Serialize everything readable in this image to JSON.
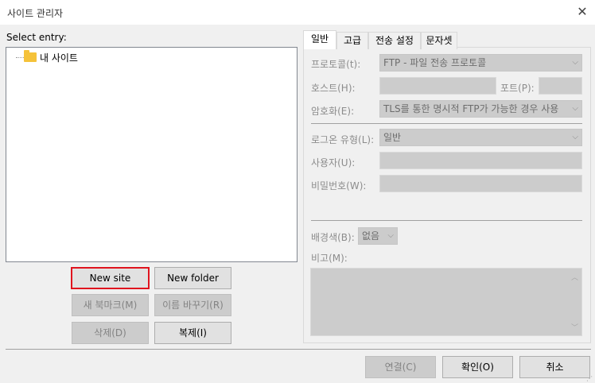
{
  "window": {
    "title": "사이트 관리자",
    "close_icon": "close-icon"
  },
  "left": {
    "select_label": "Select entry:",
    "tree": [
      {
        "label": "내 사이트",
        "icon": "folder-icon"
      }
    ],
    "buttons": {
      "new_site": "New site",
      "new_folder": "New folder",
      "new_bookmark": "새 북마크(M)",
      "rename": "이름 바꾸기(R)",
      "delete": "삭제(D)",
      "duplicate": "복제(I)"
    }
  },
  "tabs": [
    {
      "label": "일반",
      "active": true
    },
    {
      "label": "고급"
    },
    {
      "label": "전송 설정"
    },
    {
      "label": "문자셋"
    }
  ],
  "general": {
    "protocol_label": "프로토콜(t):",
    "protocol_value": "FTP - 파일 전송 프로토콜",
    "host_label": "호스트(H):",
    "host_value": "",
    "port_label": "포트(P):",
    "port_value": "",
    "encryption_label": "암호화(E):",
    "encryption_value": "TLS를 통한 명시적 FTP가 가능한 경우 사용",
    "logon_label": "로그온 유형(L):",
    "logon_value": "일반",
    "user_label": "사용자(U):",
    "user_value": "",
    "password_label": "비밀번호(W):",
    "password_value": "",
    "bg_label": "배경색(B):",
    "bg_value": "없음",
    "comment_label": "비고(M):"
  },
  "footer": {
    "connect": "연결(C)",
    "ok": "확인(O)",
    "cancel": "취소"
  },
  "colors": {
    "focus_border": "#e0141e",
    "folder": "#f5c23a"
  }
}
